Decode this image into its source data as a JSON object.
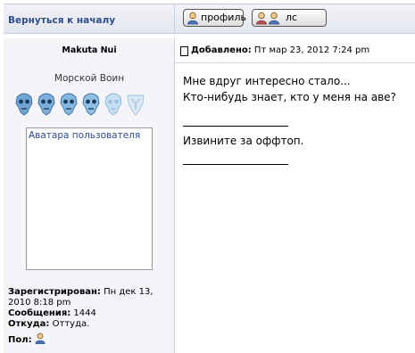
{
  "nav": {
    "back_label": "Вернуться к началу"
  },
  "buttons": {
    "profile_label": "профиль",
    "pm_label": "лс"
  },
  "author": {
    "name": "Makuta Nui",
    "rank": "Морской Воин",
    "avatar_alt": "Аватара пользователя"
  },
  "post": {
    "added_label": "Добавлено:",
    "added_value": "Пт мар 23, 2012 7:24 pm",
    "line1": "Мне вдруг интересно стало...",
    "line2": "Кто-нибудь знает, кто у меня на аве?",
    "line3": "Извините за оффтоп."
  },
  "info": {
    "registered_label": "Зарегистрирован:",
    "registered_value": "Пн дек 13, 2010 8:18 pm",
    "messages_label": "Сообщения:",
    "messages_value": "1444",
    "from_label": "Откуда:",
    "from_value": "Оттуда.",
    "gender_label": "Пол:"
  },
  "icons": {
    "post": "post-icon",
    "profile": "person-icon",
    "pm": "person-pair-icon",
    "gender": "male-icon",
    "rank": "mask-icon"
  },
  "colors": {
    "link": "#2e4d8a",
    "row_bg": "#f4f5f9",
    "border": "#c9cde0"
  }
}
